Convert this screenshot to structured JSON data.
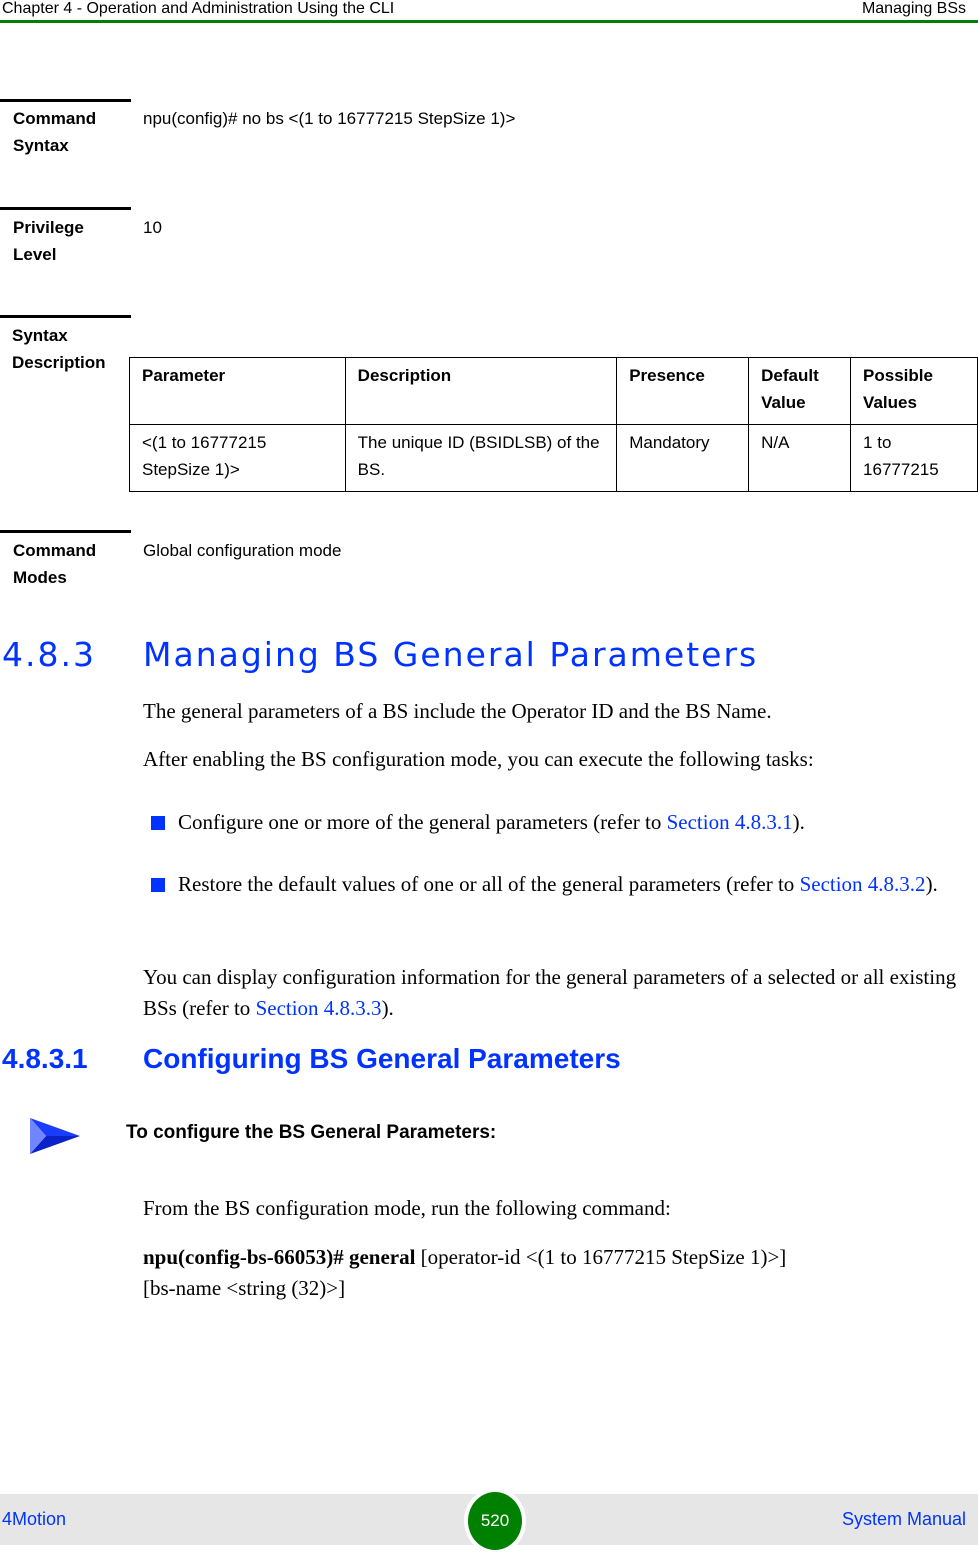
{
  "header": {
    "chapter": "Chapter 4 - Operation and Administration Using the CLI",
    "section": "Managing BSs",
    "rule_color": "#008000"
  },
  "command_syntax": {
    "label_line1": "Command",
    "label_line2": "Syntax",
    "value": "npu(config)#  no bs <(1 to 16777215 StepSize 1)>"
  },
  "privilege_level": {
    "label_line1": "Privilege",
    "label_line2": "Level",
    "value": "10"
  },
  "syntax_description": {
    "label_line1": "Syntax",
    "label_line2": "Description",
    "columns": [
      "Parameter",
      "Description",
      "Presence",
      "Default Value",
      "Possible Values"
    ],
    "rows": [
      [
        "<(1 to 16777215 StepSize 1)>",
        "The unique ID (BSIDLSB) of the BS.",
        "Mandatory",
        "N/A",
        "1 to 16777215"
      ]
    ]
  },
  "command_modes": {
    "label_line1": "Command",
    "label_line2": "Modes",
    "value": "Global configuration mode"
  },
  "section_483": {
    "number": "4.8.3",
    "title": "Managing BS General Parameters",
    "para1": "The general parameters of a BS include the Operator ID and the BS Name.",
    "para2": "After enabling the BS configuration mode, you can execute the following tasks:",
    "bullets": [
      {
        "text": "Configure one or more of the general parameters (refer to ",
        "link": "Section 4.8.3.1",
        "after": ")."
      },
      {
        "text": "Restore the default values of one or all of the general parameters (refer to ",
        "link": "Section 4.8.3.2",
        "after": ")."
      }
    ],
    "para3_text": "You can display configuration information for the general parameters of a selected or all existing BSs (refer to ",
    "para3_link": "Section 4.8.3.3",
    "para3_after": ")."
  },
  "section_4831": {
    "number": "4.8.3.1",
    "title": "Configuring BS General Parameters",
    "procedure_heading": "To configure the BS General Parameters:",
    "para1": "From the BS configuration mode, run the following command:",
    "command_bold": "npu(config-bs-66053)# general",
    "command_rest": " [operator-id <(1 to 16777215 StepSize 1)>]",
    "command_line2": "[bs-name <string (32)>]"
  },
  "footer": {
    "product": "4Motion",
    "page_number": "520",
    "manual": "System Manual"
  },
  "colors": {
    "accent_blue": "#0033ff",
    "green": "#008000"
  }
}
